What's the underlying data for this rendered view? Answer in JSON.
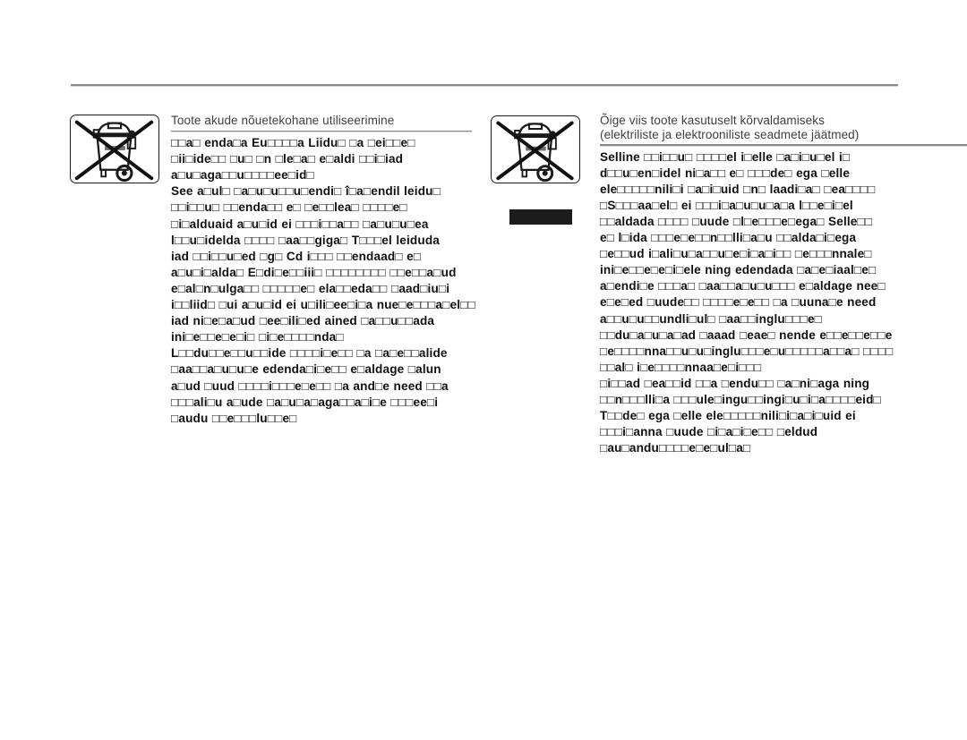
{
  "page": {
    "language": "Estonian",
    "background_color": "#ffffff",
    "rule_color": "#8a8a8a",
    "text_color": "#111111",
    "heading_color": "#3f3f3f"
  },
  "left_column": {
    "heading": "Toote akude nõuetekohane utiliseerimine",
    "icon_name": "crossed-out-wheelie-bin-battery-icon",
    "body": "□□a□ enda□a Eu□□□□a Liidu□ □a □ei□□e□\n□ii□ide□□ □u□ □n □le□a□ e□aldi □□i□iad\na□u□aga□□u□□□□ee□id□\nSee a□ul□ □a□u□u□□u□endi□ î□a□endil leidu□\n□□i□□u□ □□enda□□ e□ □e□□lea□ □□□□e□\n□i□alduaid a□u□id ei □□□i□□a□□ □a□u□u□ea\nl□□u□idelda □□□□ □aa□□giga□ T□□□el leiduda\niad □□i□□u□ed □g□ Cd i□□□ □□endaad□ e□\na□u□i□alda□ E□di□e□□iii□ □□□□□□□□ □□e□□a□ud\ne□al□n□ulga□□ □□□□□e□ ela□□eda□□ □aad□iu□i\ni□□liid□ □ui a□u□id ei u□ili□ee□i□a nue□e□□□a□el□□\niad ni□e□a□ud □ee□ili□ed ained □a□□u□□ada\nini□e□□e□e□i□ □i□e□□□□nda□\nL□□du□□e□□u□□ide □□□□i□e□□ □a □a□e□□alide\n□aa□□a□u□u□e edenda□i□e□□ e□aldage □alun\na□ud □uud □□□□i□□□e□e□□ □a and□e need □□a\n□□□ali□u a□ude □a□u□a□aga□□a□i□e □□□ee□i\n□audu □□e□□□lu□□e□"
  },
  "right_column": {
    "heading_line1": "Õige viis toote kasutuselt kõrvaldamiseks",
    "heading_line2": "(elektriliste ja elektrooniliste seadmete jäätmed)",
    "icon_name": "crossed-out-wheelie-bin-weee-icon",
    "body": "Selline □□i□□u□ □□□□el i□elle □a□i□u□el i□\nd□□u□en□idel ni□a□□ e□ □□□de□ ega □elle\nele□□□□□nili□i □a□i□uid □n□ laadi□a□ □ea□□□□\n□S□□□aa□el□ ei □□□i□a□u□u□a□a l□□e□i□el\n□□aldada □□□□ □uude □l□e□□□e□ega□ Selle□□\ne□ l□ida □□□e□e□□n□□lli□a□u □□alda□i□ega\n□e□□ud i□ali□u□a□□u□e□i□a□i□□ □e□□□nnale□\nini□e□□e□e□i□ele ning edendada □a□e□iaal□e□\na□endi□e □□□a□ □aa□□a□u□u□□□ e□aldage nee□\ne□e□ed □uude□□ □□□□e□e□□ □a □uuna□e need\na□□u□u□□undli□ul□ □aa□□inglu□□□e□\n□□du□a□u□a□ad □aaad □eae□ nende e□□e□□e□□e\n□e□□□□nna□□u□u□inglu□□□e□u□□□□□a□□a□ □□□□\n□□al□ i□e□□□□nnaa□e□i□□□\n□i□□ad □ea□□id □□a □endu□□ □a□ni□aga ning\n□□n□□□lli□a □□□ule□ingu□□ingi□u□i□a□□□□eid□\nT□□de□ ega □elle ele□□□□□nili□i□a□i□uid ei\n□□□i□anna □uude □i□a□i□e□□ □eldud\n□au□andu□□□□e□e□ul□a□"
  },
  "redaction": {
    "name": "black-redaction-bar",
    "color": "#1c1c1c"
  }
}
